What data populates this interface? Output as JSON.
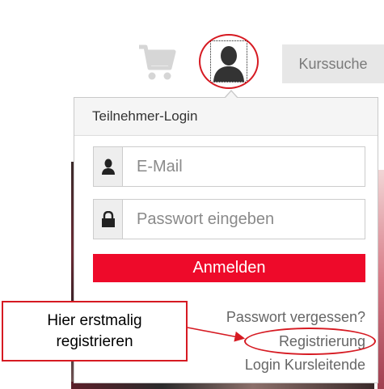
{
  "header": {
    "cart_icon": "shopping-cart-icon",
    "user_icon": "user-icon",
    "search_button_label": "Kurssuche"
  },
  "login_panel": {
    "title": "Teilnehmer-Login",
    "email": {
      "icon": "user-icon",
      "placeholder": "E-Mail",
      "value": ""
    },
    "password": {
      "icon": "lock-icon",
      "placeholder": "Passwort eingeben",
      "value": ""
    },
    "submit_label": "Anmelden",
    "links": {
      "forgot_password": "Passwort vergessen?",
      "register": "Registrierung",
      "instructor_login": "Login Kursleitende"
    }
  },
  "annotation": {
    "line1": "Hier erstmalig",
    "line2": "registrieren",
    "color": "#d61a22"
  },
  "colors": {
    "accent": "#ee0a2a",
    "annotation": "#d61a22"
  }
}
